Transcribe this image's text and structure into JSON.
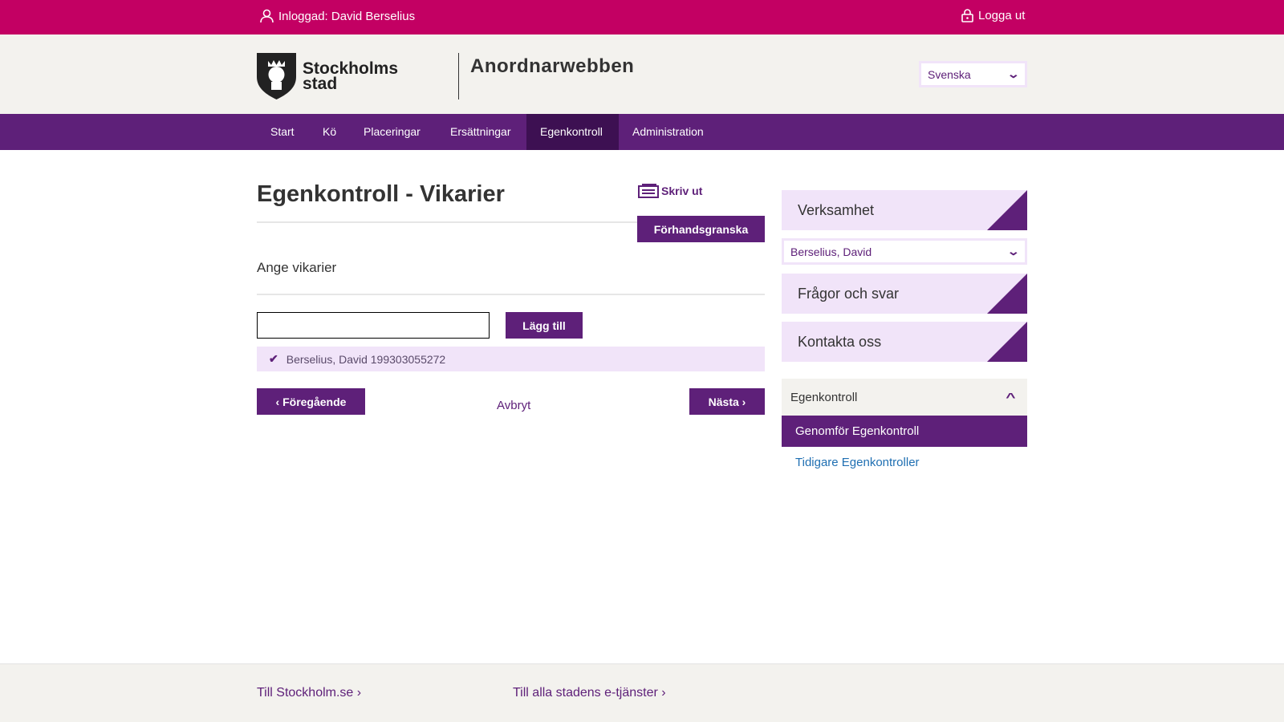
{
  "topbar": {
    "logged_in": "Inloggad: David Berselius",
    "logout": "Logga ut"
  },
  "header": {
    "logo_text_1": "Stockholms",
    "logo_text_2": "stad",
    "site_title": "Anordnarwebben",
    "language": "Svenska"
  },
  "nav": {
    "items": [
      {
        "label": "Start"
      },
      {
        "label": "Kö"
      },
      {
        "label": "Placeringar"
      },
      {
        "label": "Ersättningar"
      },
      {
        "label": "Egenkontroll",
        "active": true
      },
      {
        "label": "Administration"
      }
    ]
  },
  "main": {
    "title": "Egenkontroll - Vikarier",
    "print": "Skriv ut",
    "preview": "Förhandsgranska",
    "section": "Ange vikarier",
    "input_value": "",
    "add": "Lägg till",
    "selected": [
      {
        "text": "Berselius, David 199303055272"
      }
    ],
    "prev": "Föregående",
    "cancel": "Avbryt",
    "next": "Nästa"
  },
  "sidebar": {
    "verksamhet": "Verksamhet",
    "verksamhet_value": "Berselius, David",
    "faq": "Frågor och svar",
    "contact": "Kontakta oss",
    "menu_title": "Egenkontroll",
    "menu_items": [
      {
        "label": "Genomför Egenkontroll",
        "active": true
      },
      {
        "label": "Tidigare Egenkontroller"
      }
    ]
  },
  "footer": {
    "link1": "Till Stockholm.se ›",
    "link2": "Till alla stadens e-tjänster ›"
  },
  "colors": {
    "top": "#c30063",
    "nav": "#5e2079",
    "light": "#f1e4f9"
  }
}
